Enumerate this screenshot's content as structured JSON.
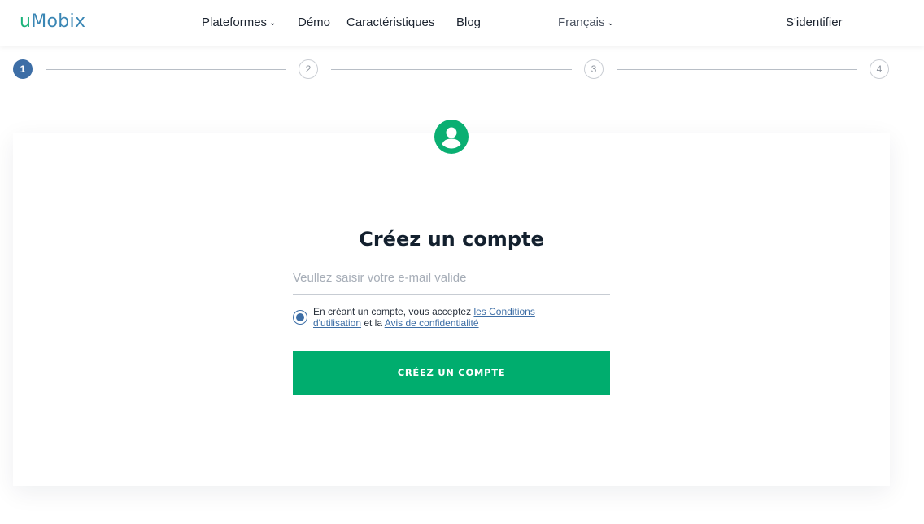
{
  "header": {
    "logo_u": "u",
    "logo_rest": "Mobix",
    "nav": {
      "platforms": "Plateformes",
      "demo": "Démo",
      "features": "Caractéristiques",
      "blog": "Blog"
    },
    "language": "Français",
    "login": "S'identifier"
  },
  "stepper": {
    "steps": [
      "1",
      "2",
      "3",
      "4"
    ],
    "active_step": 1
  },
  "form": {
    "title": "Créez un compte",
    "email_placeholder": "Veullez saisir votre e-mail valide",
    "consent_text_1": "En créant un compte, vous acceptez ",
    "terms_link": "les Conditions d'utilisation",
    "consent_text_2": " et la ",
    "privacy_link": "Avis de confidentialité",
    "submit_label": "CRÉEZ UN COMPTE"
  },
  "colors": {
    "brand_green": "#00ad6e",
    "brand_blue": "#3d6ea6",
    "avatar_green": "#0aaf72"
  },
  "icons": {
    "avatar": "user-circle-icon",
    "dropdown": "chevron-down-icon"
  }
}
